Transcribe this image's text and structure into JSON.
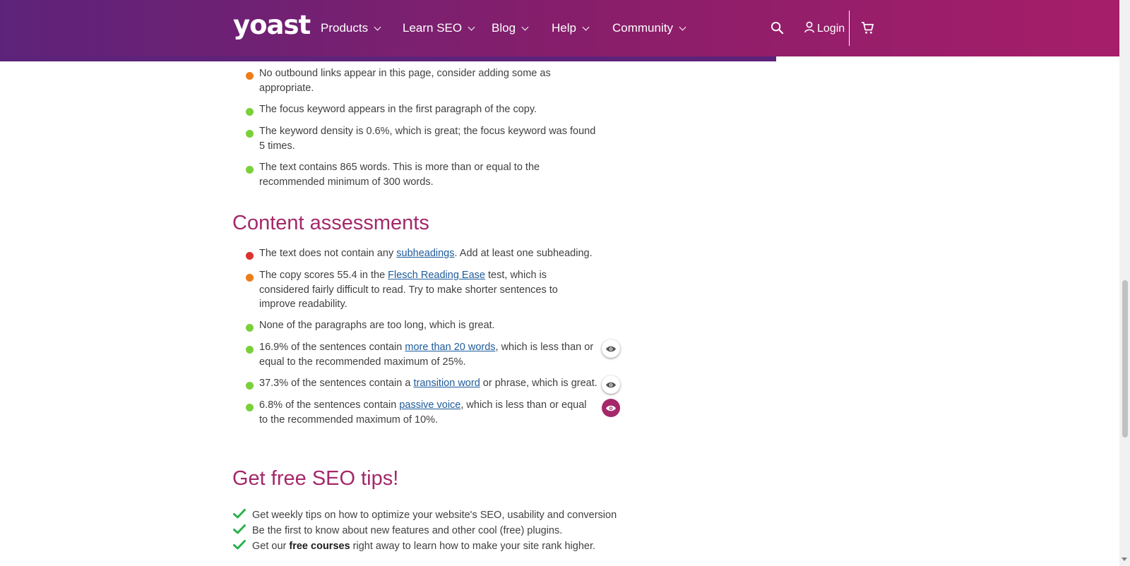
{
  "header": {
    "logo": "yoast",
    "nav": [
      "Products",
      "Learn SEO",
      "Blog",
      "Help",
      "Community"
    ],
    "login_label": "Login",
    "search_icon": "search-icon",
    "cart_icon": "cart-icon",
    "user_icon": "user-icon"
  },
  "seo_list": [
    {
      "status": "orange",
      "text": "No outbound links appear in this page, consider adding some as appropriate."
    },
    {
      "status": "green",
      "text": "The focus keyword appears in the first paragraph of the copy."
    },
    {
      "status": "green",
      "text": "The keyword density is 0.6%, which is great; the focus keyword was found 5 times."
    },
    {
      "status": "green",
      "text": "The text contains 865 words. This is more than or equal to the recommended minimum of 300 words."
    }
  ],
  "content_assessments": {
    "heading": "Content assessments",
    "items": [
      {
        "status": "red",
        "pre": "The text does not contain any ",
        "link": "subheadings",
        "post": ". Add at least one subheading."
      },
      {
        "status": "orange",
        "pre": "The copy scores 55.4 in the ",
        "link": "Flesch Reading Ease",
        "post": " test, which is considered fairly difficult to read. Try to make shorter sentences to improve readability."
      },
      {
        "status": "green",
        "pre": "None of the paragraphs are too long, which is great.",
        "link": "",
        "post": ""
      },
      {
        "status": "green",
        "pre": "16.9% of the sentences contain ",
        "link": "more than 20 words",
        "post": ", which is less than or equal to the recommended maximum of 25%.",
        "eye": "inactive"
      },
      {
        "status": "green",
        "pre": "37.3% of the sentences contain a ",
        "link": "transition word",
        "post": " or phrase, which is great.",
        "eye": "inactive"
      },
      {
        "status": "green",
        "pre": "6.8% of the sentences contain ",
        "link": "passive voice",
        "post": ", which is less than or equal to the recommended maximum of 10%.",
        "eye": "active"
      }
    ]
  },
  "tips": {
    "heading": "Get free SEO tips!",
    "items": [
      {
        "pre": "Get weekly tips on how to optimize your website's SEO, usability and conversion",
        "bold": "",
        "post": ""
      },
      {
        "pre": "Be the first to know about new features and other cool (free) plugins.",
        "bold": "",
        "post": ""
      },
      {
        "pre": "Get our ",
        "bold": "free courses",
        "post": " right away to learn how to make your site rank higher."
      }
    ]
  },
  "colors": {
    "brand_purple": "#5d237a",
    "brand_pink": "#a4286a",
    "status_green": "#7ad03a",
    "status_orange": "#ee7c1b",
    "status_red": "#dc3232",
    "tick_green": "#2bb24c"
  }
}
